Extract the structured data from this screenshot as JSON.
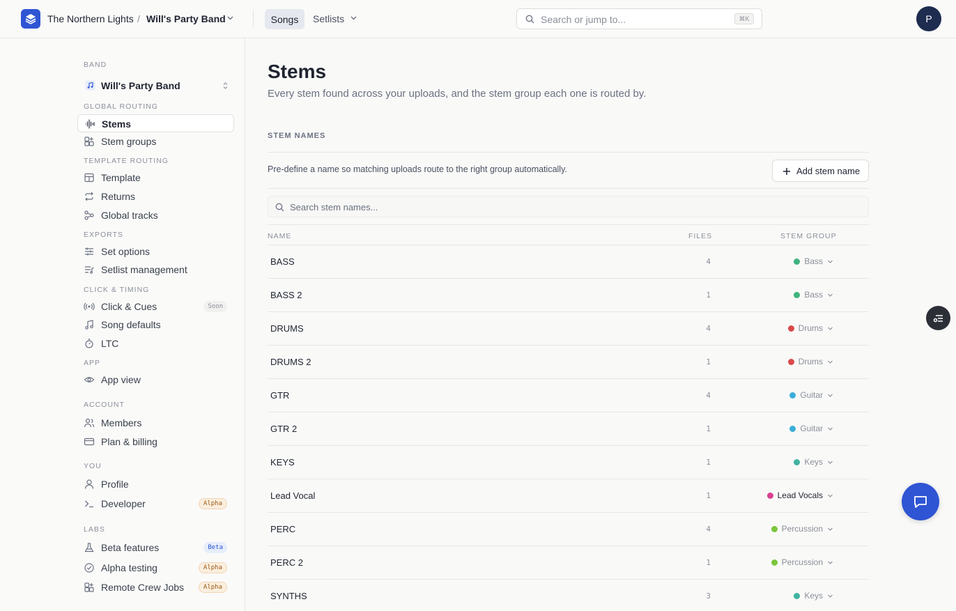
{
  "header": {
    "org_name": "The Northern Lights",
    "separator": "/",
    "band_name": "Will's Party Band",
    "tabs": [
      {
        "label": "Songs",
        "active": true
      },
      {
        "label": "Setlists",
        "active": false
      }
    ],
    "search_placeholder": "Search or jump to...",
    "search_shortcut": "⌘K",
    "avatar_initial": "P",
    "accent_color": "#2f55d4"
  },
  "sidebar": {
    "band_section": "BAND",
    "band_name": "Will's Party Band",
    "sections": {
      "global_routing": "GLOBAL ROUTING",
      "template_routing": "TEMPLATE ROUTING",
      "exports": "EXPORTS",
      "click_timing": "CLICK & TIMING",
      "app": "APP",
      "account": "ACCOUNT",
      "you": "YOU",
      "labs": "LABS"
    },
    "items": [
      {
        "label": "Stems",
        "icon": "waveform-icon",
        "active": true
      },
      {
        "label": "Stem groups",
        "icon": "grid-plus-icon"
      },
      {
        "label": "Template",
        "icon": "layout-icon"
      },
      {
        "label": "Returns",
        "icon": "repeat-icon"
      },
      {
        "label": "Global tracks",
        "icon": "nodes-icon"
      },
      {
        "label": "Set options",
        "icon": "sliders-icon"
      },
      {
        "label": "Setlist management",
        "icon": "list-music-icon"
      },
      {
        "label": "Click & Cues",
        "icon": "radio-icon",
        "badge": "Soon"
      },
      {
        "label": "Song defaults",
        "icon": "music-note-icon"
      },
      {
        "label": "LTC",
        "icon": "timer-icon"
      },
      {
        "label": "App view",
        "icon": "eye-icon"
      },
      {
        "label": "Members",
        "icon": "users-icon"
      },
      {
        "label": "Plan & billing",
        "icon": "credit-card-icon"
      },
      {
        "label": "Profile",
        "icon": "user-icon"
      },
      {
        "label": "Developer",
        "icon": "terminal-icon",
        "badge": "Alpha"
      },
      {
        "label": "Beta features",
        "icon": "flask-icon",
        "badge": "Beta"
      },
      {
        "label": "Alpha testing",
        "icon": "check-circle-icon",
        "badge": "Alpha"
      },
      {
        "label": "Remote Crew Jobs",
        "icon": "grid-plus-icon",
        "badge": "Alpha"
      }
    ]
  },
  "main": {
    "title": "Stems",
    "subtitle": "Every stem found across your uploads, and the stem group each one is routed by.",
    "section_title": "STEM NAMES",
    "help_text": "Pre-define a name so matching uploads route to the right group automatically.",
    "add_button": "Add stem name",
    "search_placeholder": "Search stem names...",
    "columns": {
      "name": "NAME",
      "files": "FILES",
      "group": "STEM GROUP"
    },
    "rows": [
      {
        "name": "BASS",
        "files": "4",
        "group": "Bass",
        "color": "#3fb37f"
      },
      {
        "name": "BASS 2",
        "files": "1",
        "group": "Bass",
        "color": "#3fb37f"
      },
      {
        "name": "DRUMS",
        "files": "4",
        "group": "Drums",
        "color": "#d94a4a"
      },
      {
        "name": "DRUMS 2",
        "files": "1",
        "group": "Drums",
        "color": "#d94a4a"
      },
      {
        "name": "GTR",
        "files": "4",
        "group": "Guitar",
        "color": "#3aaed8"
      },
      {
        "name": "GTR 2",
        "files": "1",
        "group": "Guitar",
        "color": "#3aaed8"
      },
      {
        "name": "KEYS",
        "files": "1",
        "group": "Keys",
        "color": "#3fb3a0"
      },
      {
        "name": "Lead Vocal",
        "files": "1",
        "group": "Lead Vocals",
        "color": "#d9418f"
      },
      {
        "name": "PERC",
        "files": "4",
        "group": "Percussion",
        "color": "#7cc43d"
      },
      {
        "name": "PERC 2",
        "files": "1",
        "group": "Percussion",
        "color": "#7cc43d"
      },
      {
        "name": "SYNTHS",
        "files": "3",
        "group": "Keys",
        "color": "#3fb3a0"
      }
    ]
  }
}
